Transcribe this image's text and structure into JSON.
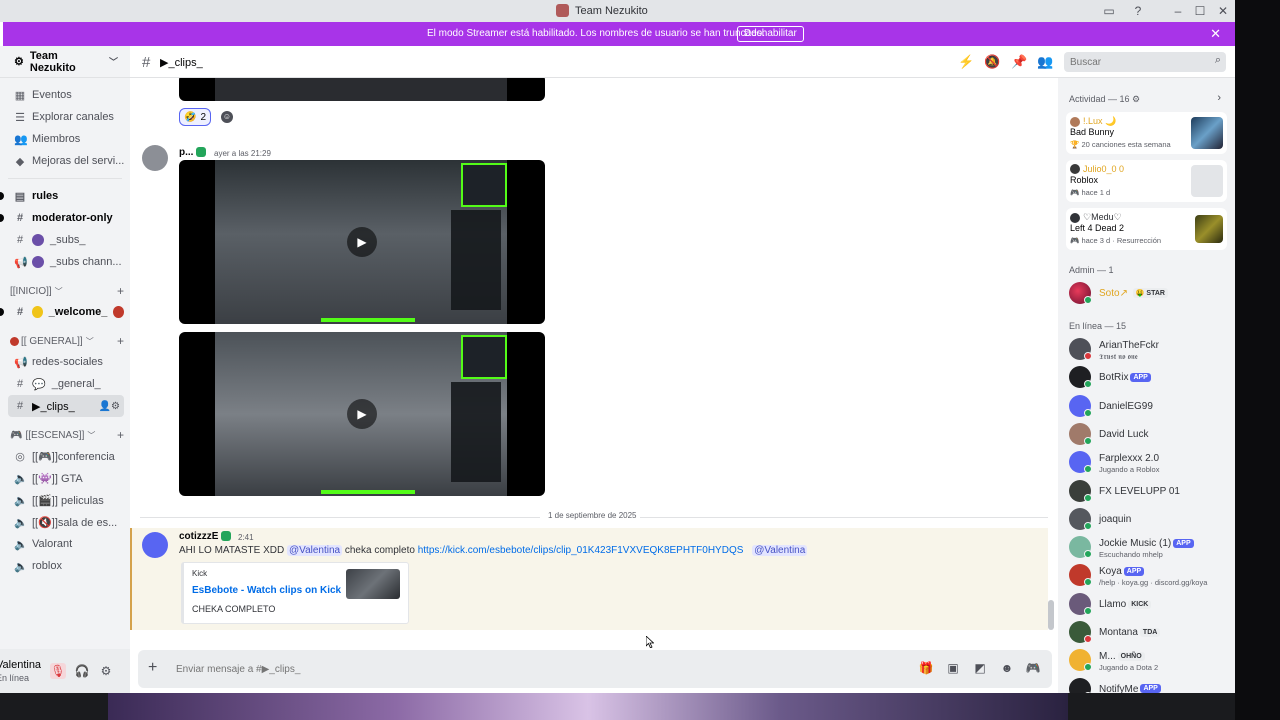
{
  "window": {
    "title": "Team Nezukito",
    "colors": {
      "accent": "#5865f2",
      "banner": "#a834e8",
      "online": "#23a55a",
      "kick_green": "#53fc18"
    }
  },
  "banner": {
    "text": "El modo Streamer está habilitado. Los nombres de usuario se han truncado.",
    "button": "Deshabilitar"
  },
  "server": {
    "name": "Team Nezukito"
  },
  "sidebar": {
    "top_items": [
      {
        "label": "Eventos",
        "icon": "calendar-icon"
      },
      {
        "label": "Explorar canales",
        "icon": "compass-icon"
      },
      {
        "label": "Miembros",
        "icon": "members-icon"
      },
      {
        "label": "Mejoras del servi...",
        "icon": "boost-icon"
      }
    ],
    "channels_a": [
      {
        "label": "rules",
        "icon": "rules-icon"
      },
      {
        "label": "moderator-only",
        "icon": "hash-icon"
      },
      {
        "label": "_subs_",
        "icon": "hash-icon"
      },
      {
        "label": "_subs chann...",
        "icon": "announcement-icon"
      }
    ],
    "categories": [
      {
        "label": "[[INICIO]]"
      },
      {
        "label": "[[ GENERAL]]"
      },
      {
        "label": "[[ESCENAS]]"
      }
    ],
    "inicio_channels": [
      {
        "label": "_welcome_"
      }
    ],
    "general_channels": [
      {
        "label": "redes-sociales"
      },
      {
        "label": "_general_"
      },
      {
        "label": "▶_clips_"
      }
    ],
    "escenas_channels": [
      {
        "label": "[[🎮]]conferencia"
      },
      {
        "label": "[[👾]] GTA"
      },
      {
        "label": "[[🎬]] peliculas"
      },
      {
        "label": "[[🔇]]sala de es..."
      },
      {
        "label": "Valorant"
      },
      {
        "label": "roblox"
      }
    ]
  },
  "user": {
    "name": "Valentina",
    "status": "En línea"
  },
  "channel": {
    "name": "▶_clips_"
  },
  "search": {
    "placeholder": "Buscar"
  },
  "chat": {
    "reaction": {
      "emoji": "🤣",
      "count": "2"
    },
    "msg1": {
      "author": "p...",
      "time": "ayer a las 21:29"
    },
    "date_divider": "1 de septiembre de 2025",
    "msg2": {
      "author": "cotizzzE",
      "time": "2:41",
      "text_a": "AHI LO MATASTE XDD",
      "mention": "@Valentina",
      "text_b": "cheka completo",
      "link": "https://kick.com/esbebote/clips/clip_01K423F1VXVEQK8EPHTF0HYDQS",
      "mention2": "@Valentina",
      "embed": {
        "provider": "Kick",
        "title": "EsBebote - Watch clips on Kick",
        "description": "CHEKA COMPLETO"
      }
    }
  },
  "composer": {
    "placeholder": "Enviar mensaje a #▶_clips_"
  },
  "members": {
    "activity_title": "Actividad — 16",
    "activities": [
      {
        "user": "!.Lux 🌙",
        "game": "Bad Bunny",
        "meta": "20 canciones esta semana",
        "color": "#e0a520"
      },
      {
        "user": "Julio0_0 0",
        "game": "Roblox",
        "meta": "hace 1 d",
        "color": "#e0a520"
      },
      {
        "user": "♡Medu♡",
        "game": "Left 4 Dead 2",
        "meta": "hace 3 d · Resurrección",
        "color": "#313338"
      }
    ],
    "admin_title": "Admin — 1",
    "admin": {
      "name": "Soto↗",
      "tag": "STAR"
    },
    "online_title": "En línea — 15",
    "list": [
      {
        "name": "ArianTheFckr",
        "sub": "𝕿𝖗𝖚𝖘𝖙 𝖓𝖔 𝖔𝖓𝖊",
        "tag": "",
        "status": "#da373c"
      },
      {
        "name": "BotRix",
        "sub": "",
        "tag": "APP",
        "status": "#23a55a"
      },
      {
        "name": "DanielEG99",
        "sub": "",
        "tag": "",
        "status": "#23a55a"
      },
      {
        "name": "David Luck",
        "sub": "",
        "tag": "",
        "status": "#23a55a"
      },
      {
        "name": "Farplexxx 2.0",
        "sub": "Jugando a Roblox",
        "tag": "",
        "status": "#23a55a"
      },
      {
        "name": "FX LEVELUPP 01",
        "sub": "",
        "tag": "",
        "status": "#23a55a"
      },
      {
        "name": "joaquin",
        "sub": "",
        "tag": "",
        "status": "#23a55a"
      },
      {
        "name": "Jockie Music (1)",
        "sub": "Escuchando mhelp",
        "tag": "APP",
        "status": "#23a55a"
      },
      {
        "name": "Koya",
        "sub": "/help · koya.gg · discord.gg/koya",
        "tag": "APP",
        "status": "#23a55a"
      },
      {
        "name": "Llamo",
        "sub": "",
        "tag": "KICK",
        "status": "#23a55a"
      },
      {
        "name": "Montana",
        "sub": "",
        "tag": "TDA",
        "status": "#da373c"
      },
      {
        "name": "M...",
        "sub": "Jugando a Dota 2",
        "tag": "OHÑO",
        "status": "#23a55a"
      },
      {
        "name": "NotifyMe",
        "sub": "",
        "tag": "APP",
        "status": "#23a55a"
      }
    ]
  }
}
